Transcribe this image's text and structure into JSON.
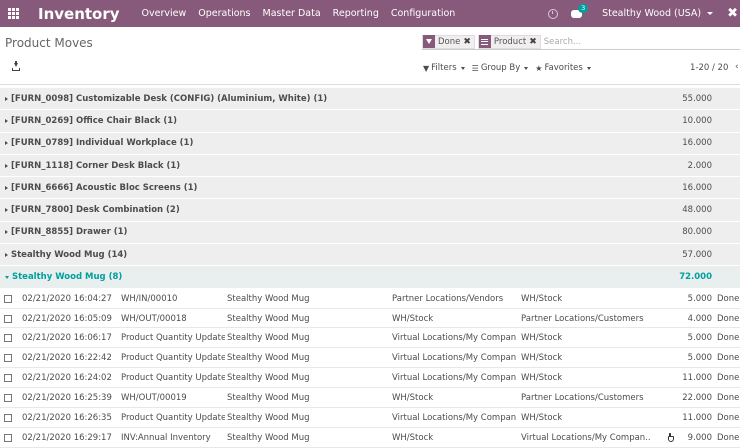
{
  "navbar": {
    "brand": "Inventory",
    "menu": [
      "Overview",
      "Operations",
      "Master Data",
      "Reporting",
      "Configuration"
    ],
    "chat_count": "3",
    "company": "Stealthy Wood (USA)",
    "debug_glyph": "✖"
  },
  "control_panel": {
    "title": "Product Moves",
    "facets": [
      {
        "label": "Done",
        "icon": "filter-icon"
      },
      {
        "label": "Product",
        "icon": "groupby-icon"
      }
    ],
    "search_placeholder": "Search...",
    "filters_label": "Filters",
    "group_by_label": "Group By",
    "favorites_label": "Favorites",
    "pager": "1-20 / 20"
  },
  "groups": [
    {
      "label": "[FURN_0098] Customizable Desk (CONFIG) (Aluminium, White) (1)",
      "total": "55.000"
    },
    {
      "label": "[FURN_0269] Office Chair Black (1)",
      "total": "10.000"
    },
    {
      "label": "[FURN_0789] Individual Workplace (1)",
      "total": "16.000"
    },
    {
      "label": "[FURN_1118] Corner Desk Black (1)",
      "total": "2.000"
    },
    {
      "label": "[FURN_6666] Acoustic Bloc Screens (1)",
      "total": "16.000"
    },
    {
      "label": "[FURN_7800] Desk Combination (2)",
      "total": "48.000"
    },
    {
      "label": "[FURN_8855] Drawer (1)",
      "total": "80.000"
    },
    {
      "label": "Stealthy Wood Mug (14)",
      "total": "57.000"
    }
  ],
  "open_group": {
    "label": "Stealthy Wood Mug (8)",
    "total": "72.000"
  },
  "records": [
    {
      "date": "02/21/2020 16:04:27",
      "ref": "WH/IN/00010",
      "product": "Stealthy Wood Mug",
      "from": "Partner Locations/Vendors",
      "to": "WH/Stock",
      "qty": "5.000",
      "status": "Done"
    },
    {
      "date": "02/21/2020 16:05:09",
      "ref": "WH/OUT/00018",
      "product": "Stealthy Wood Mug",
      "from": "WH/Stock",
      "to": "Partner Locations/Customers",
      "qty": "4.000",
      "status": "Done"
    },
    {
      "date": "02/21/2020 16:06:17",
      "ref": "Product Quantity Updated",
      "product": "Stealthy Wood Mug",
      "from": "Virtual Locations/My Compan...",
      "to": "WH/Stock",
      "qty": "5.000",
      "status": "Done"
    },
    {
      "date": "02/21/2020 16:22:42",
      "ref": "Product Quantity Updated",
      "product": "Stealthy Wood Mug",
      "from": "Virtual Locations/My Compan...",
      "to": "WH/Stock",
      "qty": "5.000",
      "status": "Done"
    },
    {
      "date": "02/21/2020 16:24:02",
      "ref": "Product Quantity Updated",
      "product": "Stealthy Wood Mug",
      "from": "Virtual Locations/My Compan...",
      "to": "WH/Stock",
      "qty": "11.000",
      "status": "Done"
    },
    {
      "date": "02/21/2020 16:25:39",
      "ref": "WH/OUT/00019",
      "product": "Stealthy Wood Mug",
      "from": "WH/Stock",
      "to": "Partner Locations/Customers",
      "qty": "22.000",
      "status": "Done"
    },
    {
      "date": "02/21/2020 16:26:35",
      "ref": "Product Quantity Updated",
      "product": "Stealthy Wood Mug",
      "from": "Virtual Locations/My Compan...",
      "to": "WH/Stock",
      "qty": "11.000",
      "status": "Done"
    },
    {
      "date": "02/21/2020 16:29:17",
      "ref": "INV:Annual Inventory",
      "product": "Stealthy Wood Mug",
      "from": "WH/Stock",
      "to": "Virtual Locations/My Compan...",
      "qty": "9.000",
      "status": "Done"
    }
  ]
}
